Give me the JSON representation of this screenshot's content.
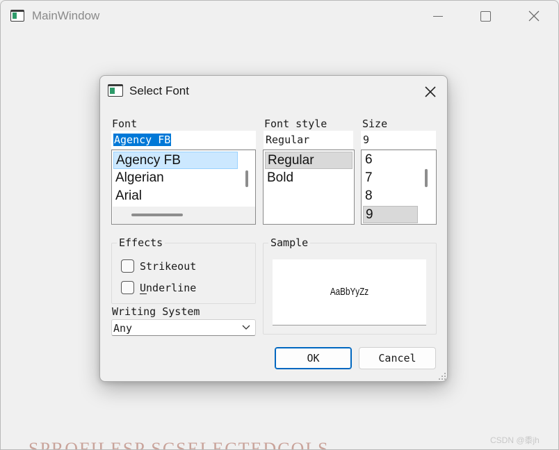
{
  "main_window": {
    "title": "MainWindow",
    "background_fragment": "SPROFILESP  SCSELECTEDCOLS",
    "watermark": "CSDN @黍jh"
  },
  "dialog": {
    "title": "Select Font",
    "font": {
      "label": "Font",
      "value": "Agency FB",
      "items": [
        "Agency FB",
        "Algerian",
        "Arial"
      ],
      "selected": "Agency FB"
    },
    "style": {
      "label": "Font style",
      "value": "Regular",
      "items": [
        "Regular",
        "Bold"
      ],
      "selected": "Regular"
    },
    "size": {
      "label": "Size",
      "value": "9",
      "items": [
        "6",
        "7",
        "8",
        "9"
      ],
      "selected": "9"
    },
    "effects": {
      "title": "Effects",
      "strikeout": {
        "label": "Strikeout",
        "checked": false
      },
      "underline": {
        "label": "Underline",
        "checked": false
      }
    },
    "writing_system": {
      "label": "Writing System",
      "value": "Any"
    },
    "sample": {
      "title": "Sample",
      "text": "AaBbYyZz"
    },
    "buttons": {
      "ok": "OK",
      "cancel": "Cancel"
    }
  },
  "colors": {
    "accent": "#0078d7",
    "selection_bg": "#cce8ff",
    "selection_grey": "#d9d9d9",
    "window_bg": "#f0f0f0"
  },
  "icons": [
    "app-icon",
    "minimize-icon",
    "maximize-icon",
    "close-icon",
    "chevron-down-icon",
    "size-grip-icon"
  ]
}
